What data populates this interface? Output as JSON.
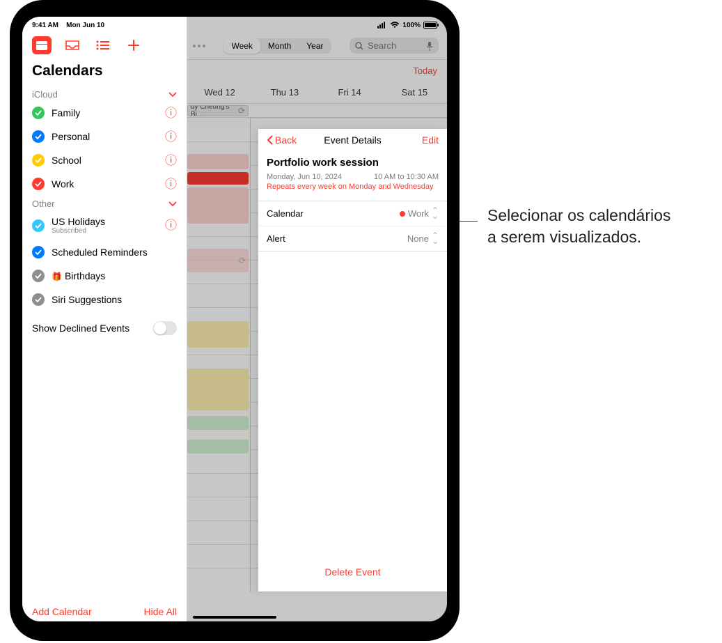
{
  "statusbar": {
    "time": "9:41 AM",
    "date": "Mon Jun 10",
    "battery_pct": "100%"
  },
  "sidebar": {
    "title": "Calendars",
    "sections": [
      {
        "name": "iCloud",
        "items": [
          {
            "label": "Family",
            "color": "#34c759",
            "info": true
          },
          {
            "label": "Personal",
            "color": "#007aff",
            "info": true
          },
          {
            "label": "School",
            "color": "#ffcc00",
            "info": true
          },
          {
            "label": "Work",
            "color": "#ff3b30",
            "info": true
          }
        ]
      },
      {
        "name": "Other",
        "items": [
          {
            "label": "US Holidays",
            "sub": "Subscribed",
            "color": "#34c8ff",
            "info": true
          },
          {
            "label": "Scheduled Reminders",
            "color": "#007aff"
          },
          {
            "label": "Birthdays",
            "color": "#8e8e93",
            "birthday": true
          },
          {
            "label": "Siri Suggestions",
            "color": "#8e8e93"
          }
        ]
      }
    ],
    "declined_label": "Show Declined Events",
    "footer": {
      "add": "Add Calendar",
      "hide": "Hide All"
    }
  },
  "main": {
    "segments": [
      "Week",
      "Month",
      "Year"
    ],
    "search_placeholder": "Search",
    "today_label": "Today",
    "days": [
      "Wed 12",
      "Thu 13",
      "Fri 14",
      "Sat 15"
    ],
    "event_chip": "dy Cheung's Bi…"
  },
  "detail": {
    "back": "Back",
    "title": "Event Details",
    "edit": "Edit",
    "event_title": "Portfolio work session",
    "date": "Monday, Jun 10, 2024",
    "time": "10 AM to 10:30 AM",
    "repeats": "Repeats every week on Monday and Wednesday",
    "rows": {
      "calendar_label": "Calendar",
      "calendar_value": "Work",
      "alert_label": "Alert",
      "alert_value": "None"
    },
    "delete": "Delete Event"
  },
  "callout": {
    "line1": "Selecionar os calendários",
    "line2": "a serem visualizados."
  },
  "chart_data": null
}
